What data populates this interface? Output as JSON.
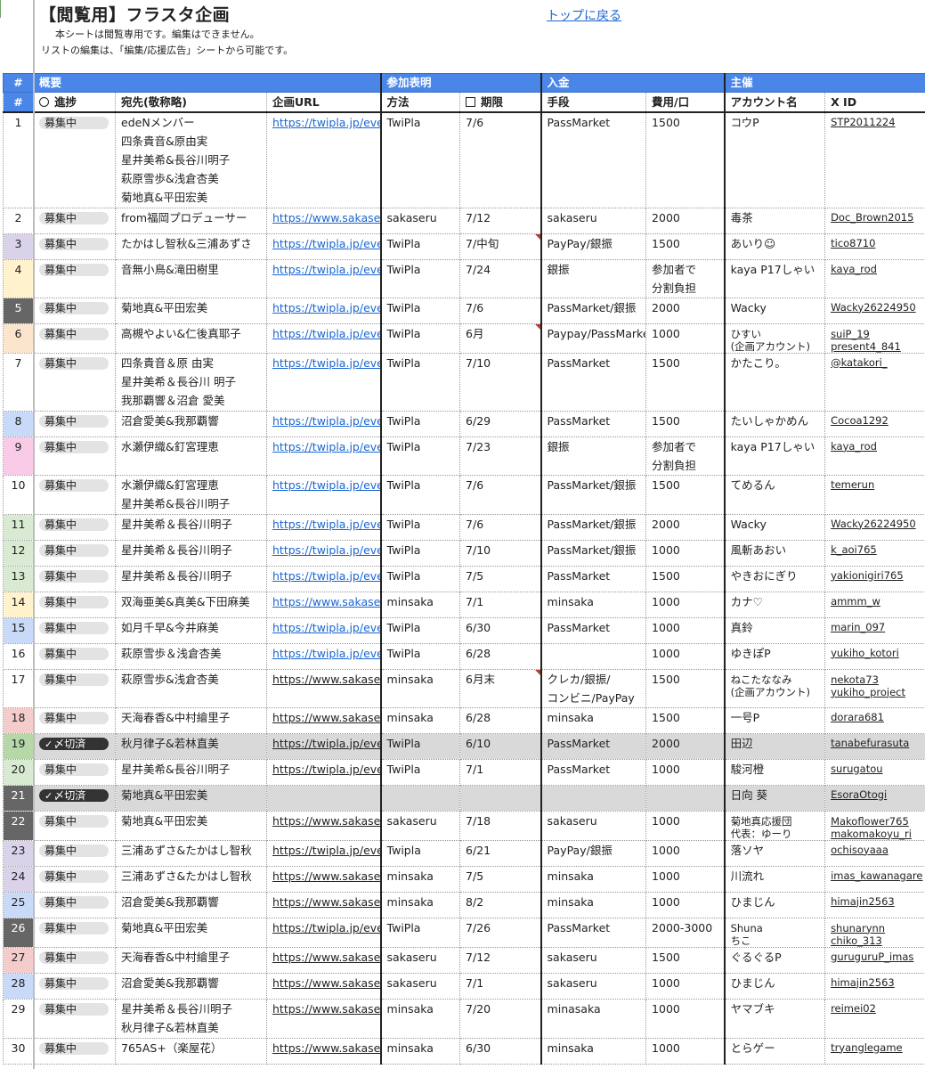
{
  "page": {
    "title": "【閲覧用】フラスタ企画",
    "note1": "本シートは閲覧専用です。編集はできません。",
    "note2": "リストの編集は、「編集/応援広告」シートから可能です。",
    "top_link": "トップに戻る"
  },
  "groups": {
    "num": "#",
    "overview": "概要",
    "participation": "参加表明",
    "payment": "入金",
    "host": "主催"
  },
  "columns": {
    "num": "#",
    "status": "進捗",
    "to": "宛先(敬称略)",
    "url": "企画URL",
    "method": "方法",
    "deadline": "期限",
    "means": "手段",
    "cost": "費用/口",
    "account": "アカウント名",
    "xid": "X ID"
  },
  "rows": [
    {
      "no": "1",
      "status": "募集中",
      "to": [
        "edeNメンバー",
        "四条貴音&原由実",
        "星井美希&長谷川明子",
        "萩原雪歩&浅倉杏美",
        "菊地真&平田宏美"
      ],
      "url": "https://twipla.jp/event",
      "url_link": true,
      "method": "TwiPla",
      "deadline": "7/6",
      "means": "PassMarket",
      "cost": [
        "1500"
      ],
      "account": [
        "コウP"
      ],
      "xid": [
        "STP2011224"
      ],
      "color": "#ffffff"
    },
    {
      "no": "2",
      "status": "募集中",
      "to": [
        "from福岡プロデューサー"
      ],
      "url": "https://www.sakaseru",
      "url_link": true,
      "method": "sakaseru",
      "deadline": "7/12",
      "means": "sakaseru",
      "cost": [
        "2000"
      ],
      "account": [
        "毒茶"
      ],
      "xid": [
        "Doc_Brown2015"
      ],
      "color": "#ffffff"
    },
    {
      "no": "3",
      "status": "募集中",
      "to": [
        "たかはし智秋&三浦あずさ"
      ],
      "url": "https://twipla.jp/event",
      "url_link": true,
      "method": "TwiPla",
      "deadline": "7/中旬",
      "means": "PayPay/銀振",
      "cost": [
        "1500"
      ],
      "account": [
        "あいり☺"
      ],
      "xid": [
        "tico8710"
      ],
      "color": "#d9d2e9",
      "tri": true
    },
    {
      "no": "4",
      "status": "募集中",
      "to": [
        "音無小鳥&滝田樹里"
      ],
      "url": "https://twipla.jp/event",
      "url_link": true,
      "method": "TwiPla",
      "deadline": "7/24",
      "means": "銀振",
      "cost": [
        "参加者で",
        "分割負担"
      ],
      "account": [
        "kaya P17しゃい"
      ],
      "xid": [
        "kaya_rod"
      ],
      "color": "#fff2cc"
    },
    {
      "no": "5",
      "status": "募集中",
      "to": [
        "菊地真&平田宏美"
      ],
      "url": "https://twipla.jp/event",
      "url_link": true,
      "method": "TwiPla",
      "deadline": "7/6",
      "means": "PassMarket/銀振",
      "cost": [
        "2000"
      ],
      "account": [
        "Wacky"
      ],
      "xid": [
        "Wacky26224950"
      ],
      "color": "#666666",
      "numwhite": true
    },
    {
      "no": "6",
      "status": "募集中",
      "to": [
        "高槻やよい&仁後真耶子"
      ],
      "url": "https://twipla.jp/event",
      "url_link": true,
      "method": "TwiPla",
      "deadline": "6月",
      "means": "Paypay/PassMarke",
      "cost": [
        "1000"
      ],
      "account": [
        "ひすい",
        "(企画アカウント)"
      ],
      "xid": [
        "suiP_19",
        "present4_841"
      ],
      "color": "#fce5cd",
      "tri": true
    },
    {
      "no": "7",
      "status": "募集中",
      "to": [
        "四条貴音＆原 由実",
        "星井美希＆長谷川 明子",
        "我那覇響＆沼倉 愛美"
      ],
      "url": "https://twipla.jp/event",
      "url_link": true,
      "method": "TwiPla",
      "deadline": "7/10",
      "means": "PassMarket",
      "cost": [
        "1500"
      ],
      "account": [
        "かたこり。"
      ],
      "xid": [
        "@katakori_"
      ],
      "color": "#ffffff"
    },
    {
      "no": "8",
      "status": "募集中",
      "to": [
        "沼倉愛美&我那覇響"
      ],
      "url": "https://twipla.jp/event",
      "url_link": true,
      "method": "TwiPla",
      "deadline": "6/29",
      "means": "PassMarket",
      "cost": [
        "1500"
      ],
      "account": [
        "たいしゃかめん"
      ],
      "xid": [
        "Cocoa1292"
      ],
      "color": "#c9daf8"
    },
    {
      "no": "9",
      "status": "募集中",
      "to": [
        "水瀬伊織&釘宮理恵"
      ],
      "url": "https://twipla.jp/event",
      "url_link": true,
      "method": "TwiPla",
      "deadline": "7/23",
      "means": "銀振",
      "cost": [
        "参加者で",
        "分割負担"
      ],
      "account": [
        "kaya P17しゃい"
      ],
      "xid": [
        "kaya_rod"
      ],
      "color": "#f9cbe7"
    },
    {
      "no": "10",
      "status": "募集中",
      "to": [
        "水瀬伊織&釘宮理恵",
        "星井美希&長谷川明子"
      ],
      "url": "https://twipla.jp/event",
      "url_link": true,
      "method": "TwiPla",
      "deadline": "7/6",
      "means": "PassMarket/銀振",
      "cost": [
        "1500"
      ],
      "account": [
        "てめるん"
      ],
      "xid": [
        "temerun"
      ],
      "color": "#ffffff"
    },
    {
      "no": "11",
      "status": "募集中",
      "to": [
        "星井美希＆長谷川明子"
      ],
      "url": "https://twipla.jp/event",
      "url_link": true,
      "method": "TwiPla",
      "deadline": "7/6",
      "means": "PassMarket/銀振",
      "cost": [
        "2000"
      ],
      "account": [
        "Wacky"
      ],
      "xid": [
        "Wacky26224950"
      ],
      "color": "#d9ead3"
    },
    {
      "no": "12",
      "status": "募集中",
      "to": [
        "星井美希＆長谷川明子"
      ],
      "url": "https://twipla.jp/event",
      "url_link": true,
      "method": "TwiPla",
      "deadline": "7/10",
      "means": "PassMarket/銀振",
      "cost": [
        "1000"
      ],
      "account": [
        "風斬あおい"
      ],
      "xid": [
        "k_aoi765"
      ],
      "color": "#d9ead3"
    },
    {
      "no": "13",
      "status": "募集中",
      "to": [
        "星井美希＆長谷川明子"
      ],
      "url": "https://twipla.jp/event",
      "url_link": true,
      "method": "TwiPla",
      "deadline": "7/5",
      "means": "PassMarket",
      "cost": [
        "1500"
      ],
      "account": [
        "やきおにぎり"
      ],
      "xid": [
        "yakionigiri765"
      ],
      "color": "#d9ead3"
    },
    {
      "no": "14",
      "status": "募集中",
      "to": [
        "双海亜美&真美&下田麻美"
      ],
      "url": "https://www.sakaseru",
      "url_link": true,
      "method": "minsaka",
      "deadline": "7/1",
      "means": "minsaka",
      "cost": [
        "1000"
      ],
      "account": [
        "カナ♡"
      ],
      "xid": [
        "ammm_w"
      ],
      "color": "#fff2cc"
    },
    {
      "no": "15",
      "status": "募集中",
      "to": [
        "如月千早&今井麻美"
      ],
      "url": "https://twipla.jp/event",
      "url_link": true,
      "method": "TwiPla",
      "deadline": "6/30",
      "means": "PassMarket",
      "cost": [
        "1000"
      ],
      "account": [
        "真鈴"
      ],
      "xid": [
        "marin_097"
      ],
      "color": "#c9daf8"
    },
    {
      "no": "16",
      "status": "募集中",
      "to": [
        "萩原雪歩＆浅倉杏美"
      ],
      "url": "https://twipla.jp/event",
      "url_link": true,
      "method": "TwiPla",
      "deadline": "6/28",
      "means": "",
      "cost": [
        "1000"
      ],
      "account": [
        "ゆきぽP"
      ],
      "xid": [
        "yukiho_kotori"
      ],
      "color": "#ffffff"
    },
    {
      "no": "17",
      "status": "募集中",
      "to": [
        "萩原雪歩&浅倉杏美"
      ],
      "url": "https://www.sakaseru",
      "url_link": false,
      "method": "minsaka",
      "deadline": "6月末",
      "means": "クレカ/銀振/",
      "means2": "コンビニ/PayPay",
      "cost": [
        "1500"
      ],
      "account": [
        "ねこたななみ",
        "(企画アカウント)"
      ],
      "xid": [
        "nekota73",
        "yukiho_project"
      ],
      "color": "#ffffff",
      "tri": true
    },
    {
      "no": "18",
      "status": "募集中",
      "to": [
        "天海春香&中村繪里子"
      ],
      "url": "https://www.sakaseru",
      "url_link": false,
      "method": "minsaka",
      "deadline": "6/28",
      "means": "minsaka",
      "cost": [
        "1500"
      ],
      "account": [
        "一号P"
      ],
      "xid": [
        "dorara681"
      ],
      "color": "#f4cccc"
    },
    {
      "no": "19",
      "status": "〆切済",
      "closed": true,
      "to": [
        "秋月律子&若林直美"
      ],
      "url": "https://twipla.jp/event",
      "url_link": false,
      "method": "TwiPla",
      "deadline": "6/10",
      "means": "PassMarket",
      "cost": [
        "2000"
      ],
      "account": [
        "田辺"
      ],
      "xid": [
        "tanabefurasuta"
      ],
      "color": "#b6d7a8",
      "gray": true
    },
    {
      "no": "20",
      "status": "募集中",
      "to": [
        "星井美希&長谷川明子"
      ],
      "url": "https://twipla.jp/event",
      "url_link": false,
      "method": "TwiPla",
      "deadline": "7/1",
      "means": "PassMarket",
      "cost": [
        "1000"
      ],
      "account": [
        "駿河橙"
      ],
      "xid": [
        "surugatou"
      ],
      "color": "#d9ead3"
    },
    {
      "no": "21",
      "status": "〆切済",
      "closed": true,
      "to": [
        "菊地真&平田宏美"
      ],
      "url": "",
      "url_link": false,
      "method": "",
      "deadline": "",
      "means": "",
      "cost": [
        ""
      ],
      "account": [
        "日向 葵"
      ],
      "xid": [
        "EsoraOtogi"
      ],
      "color": "#666666",
      "numwhite": true,
      "gray": true
    },
    {
      "no": "22",
      "status": "募集中",
      "to": [
        "菊地真&平田宏美"
      ],
      "url": "https://www.sakaseru",
      "url_link": false,
      "method": "sakaseru",
      "deadline": "7/18",
      "means": "sakaseru",
      "cost": [
        "1000"
      ],
      "account": [
        "菊地真応援団",
        "代表：ゆーり"
      ],
      "xid": [
        "Makoflower765",
        "makomakoyu_ri"
      ],
      "color": "#666666",
      "numwhite": true
    },
    {
      "no": "23",
      "status": "募集中",
      "to": [
        "三浦あずさ&たかはし智秋"
      ],
      "url": "https://twipla.jp/event",
      "url_link": false,
      "method": "Twipla",
      "deadline": "6/21",
      "means": "PayPay/銀振",
      "cost": [
        "1000"
      ],
      "account": [
        "落ソヤ"
      ],
      "xid": [
        "ochisoyaaa"
      ],
      "color": "#d9d2e9"
    },
    {
      "no": "24",
      "status": "募集中",
      "to": [
        "三浦あずさ&たかはし智秋"
      ],
      "url": "https://www.sakaseru",
      "url_link": false,
      "method": "minsaka",
      "deadline": "7/5",
      "means": "minsaka",
      "cost": [
        "1000"
      ],
      "account": [
        "川流れ"
      ],
      "xid": [
        "imas_kawanagare"
      ],
      "color": "#d9d2e9"
    },
    {
      "no": "25",
      "status": "募集中",
      "to": [
        "沼倉愛美&我那覇響"
      ],
      "url": "https://www.sakaseru",
      "url_link": false,
      "method": "minsaka",
      "deadline": "8/2",
      "means": "minsaka",
      "cost": [
        "1000"
      ],
      "account": [
        "ひまじん"
      ],
      "xid": [
        "himajin2563"
      ],
      "color": "#c9daf8"
    },
    {
      "no": "26",
      "status": "募集中",
      "to": [
        "菊地真&平田宏美"
      ],
      "url": "https://twipla.jp/event",
      "url_link": false,
      "method": "TwiPla",
      "deadline": "7/26",
      "means": "PassMarket",
      "cost": [
        "2000-3000"
      ],
      "account": [
        "Shuna",
        "ちこ"
      ],
      "xid": [
        "shunarynn",
        "chiko_313"
      ],
      "color": "#666666",
      "numwhite": true
    },
    {
      "no": "27",
      "status": "募集中",
      "to": [
        "天海春香&中村繪里子"
      ],
      "url": "https://www.sakaseru",
      "url_link": false,
      "method": "sakaseru",
      "deadline": "7/12",
      "means": "sakaseru",
      "cost": [
        "1500"
      ],
      "account": [
        "ぐるぐるP"
      ],
      "xid": [
        "guruguruP_imas"
      ],
      "color": "#f4cccc"
    },
    {
      "no": "28",
      "status": "募集中",
      "to": [
        "沼倉愛美&我那覇響"
      ],
      "url": "https://www.sakaseru",
      "url_link": false,
      "method": "sakaseru",
      "deadline": "7/1",
      "means": "sakaseru",
      "cost": [
        "1000"
      ],
      "account": [
        "ひまじん"
      ],
      "xid": [
        "himajin2563"
      ],
      "color": "#c9daf8"
    },
    {
      "no": "29",
      "status": "募集中",
      "to": [
        "星井美希＆長谷川明子",
        "秋月律子&若林直美"
      ],
      "url": "https://www.sakaseru",
      "url_link": false,
      "method": "minsaka",
      "deadline": "7/20",
      "means": "minasaka",
      "cost": [
        "1000"
      ],
      "account": [
        "ヤマブキ"
      ],
      "xid": [
        "reimei02"
      ],
      "color": "#ffffff"
    },
    {
      "no": "30",
      "status": "募集中",
      "to": [
        "765AS+（楽屋花）"
      ],
      "url": "https://www.sakaseru",
      "url_link": false,
      "method": "minsaka",
      "deadline": "6/30",
      "means": "minsaka",
      "cost": [
        "1000"
      ],
      "account": [
        "とらゲー"
      ],
      "xid": [
        "tryanglegame"
      ],
      "color": "#ffffff"
    }
  ]
}
